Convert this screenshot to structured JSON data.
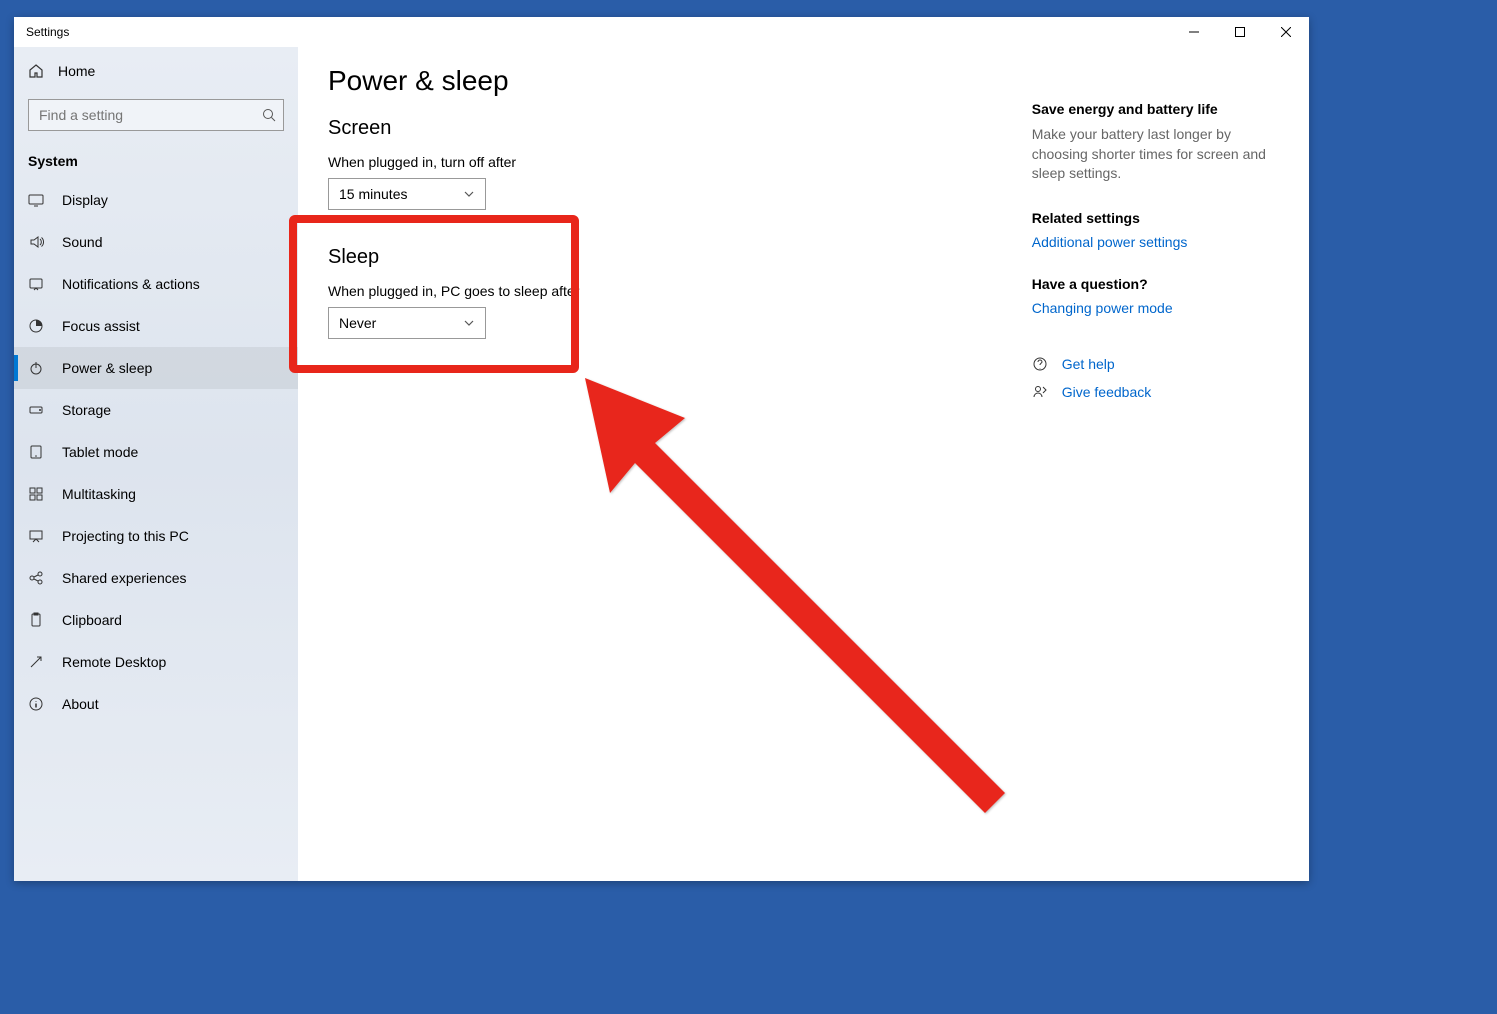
{
  "titlebar": {
    "title": "Settings"
  },
  "sidebar": {
    "home": "Home",
    "search_placeholder": "Find a setting",
    "header": "System",
    "items": [
      {
        "label": "Display"
      },
      {
        "label": "Sound"
      },
      {
        "label": "Notifications & actions"
      },
      {
        "label": "Focus assist"
      },
      {
        "label": "Power & sleep"
      },
      {
        "label": "Storage"
      },
      {
        "label": "Tablet mode"
      },
      {
        "label": "Multitasking"
      },
      {
        "label": "Projecting to this PC"
      },
      {
        "label": "Shared experiences"
      },
      {
        "label": "Clipboard"
      },
      {
        "label": "Remote Desktop"
      },
      {
        "label": "About"
      }
    ]
  },
  "page": {
    "title": "Power & sleep",
    "screen": {
      "title": "Screen",
      "label": "When plugged in, turn off after",
      "value": "15 minutes"
    },
    "sleep": {
      "title": "Sleep",
      "label": "When plugged in, PC goes to sleep after",
      "value": "Never"
    }
  },
  "side": {
    "energy_title": "Save energy and battery life",
    "energy_text": "Make your battery last longer by choosing shorter times for screen and sleep settings.",
    "related_title": "Related settings",
    "related_link": "Additional power settings",
    "question_title": "Have a question?",
    "question_link": "Changing power mode",
    "help": "Get help",
    "feedback": "Give feedback"
  },
  "annotation": {
    "highlight_color": "#e8261a"
  }
}
